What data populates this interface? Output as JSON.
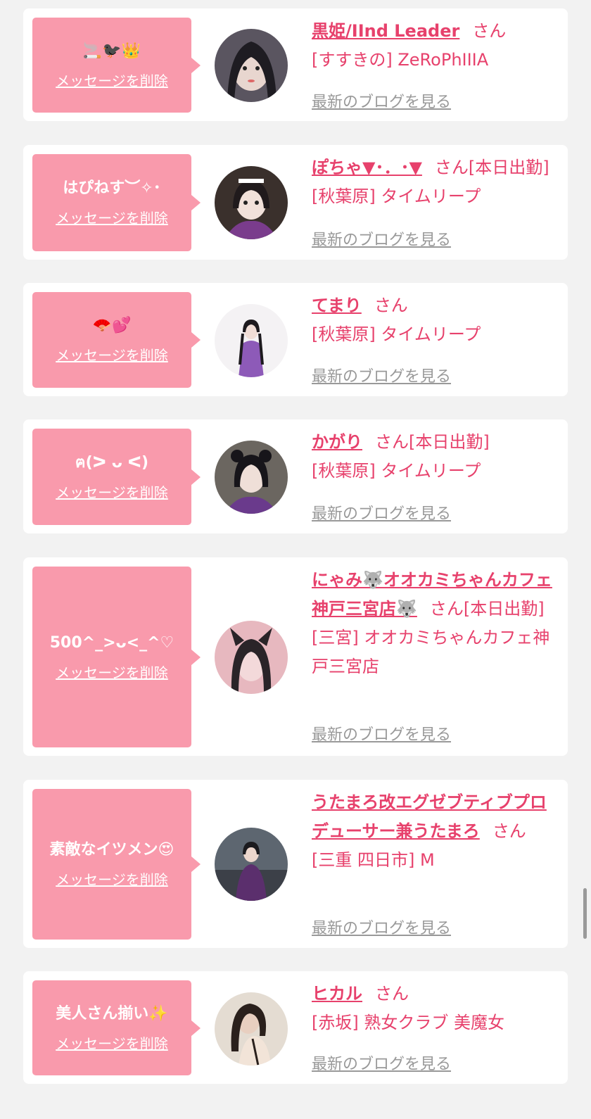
{
  "delete_label": "メッセージを削除",
  "blog_label": "最新のブログを見る",
  "san": "さん",
  "cards": [
    {
      "message": "🚬🐦‍⬛👑",
      "name": "黒姫/IInd Leader",
      "working": "",
      "location": "[すすきの] ZeRoPhIIIA"
    },
    {
      "message": "はぴねす︶✧･",
      "name": "ぽちゃ▼･．･▼",
      "working": "[本日出勤]",
      "location": "[秋葉原] タイムリープ"
    },
    {
      "message": "🪭💕",
      "name": "てまり",
      "working": "",
      "location": "[秋葉原] タイムリープ"
    },
    {
      "message": "ฅ(ᐳ ᴗ ᐸ)",
      "name": "かがり",
      "working": "[本日出勤]",
      "location": "[秋葉原] タイムリープ"
    },
    {
      "message": "500^_>ᴗ<_^♡",
      "name": "にゃみ🐺オオカミちゃんカフェ神戸三宮店🐺",
      "working": "[本日出勤]",
      "location": "[三宮] オオカミちゃんカフェ神戸三宮店"
    },
    {
      "message": "素敵なイツメン😍",
      "name": "うたまろ改エグゼブティブプロデューサー兼うたまろ",
      "working": "",
      "location": "[三重 四日市] M"
    },
    {
      "message": "美人さん揃い✨",
      "name": "ヒカル",
      "working": "",
      "location": "[赤坂] 熟女クラブ 美魔女"
    }
  ],
  "colors": {
    "accent": "#e7416c",
    "bubble": "#f99aac",
    "background": "#f2f2f2",
    "link_gray": "#999999"
  }
}
